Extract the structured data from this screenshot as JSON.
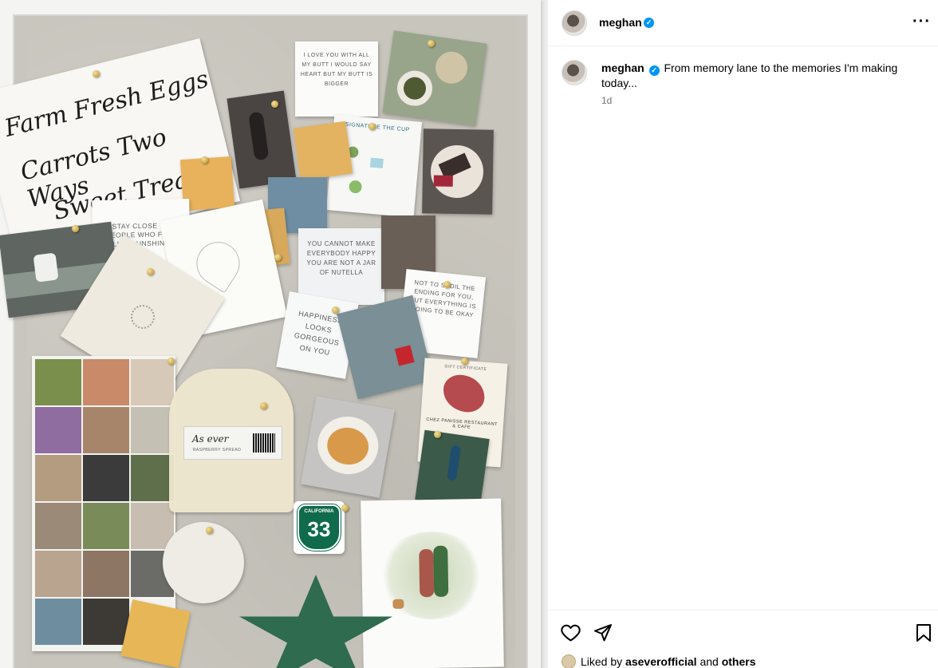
{
  "post": {
    "username": "meghan",
    "caption": {
      "username": "meghan",
      "text": "From memory lane to the memories I'm making today..."
    },
    "time": "1d",
    "likes": {
      "prefix": "Liked by",
      "user": "aseverofficial",
      "middle": "and",
      "others": "others"
    }
  },
  "icons": {
    "verified": "verified-badge-icon",
    "more": "more-options-icon",
    "like": "heart-icon",
    "share": "share-icon",
    "save": "bookmark-icon"
  },
  "colors": {
    "verified": "#0095f6",
    "border": "#efefef",
    "muted": "#737373"
  },
  "image": {
    "calligraphy_lines": [
      "Farm Fresh Eggs",
      "Carrots Two Ways",
      "Sweet Treats"
    ],
    "card_sunshine": "STAY CLOSE TO PEOPLE WHO FEEL LIKE SUNSHINE",
    "card_love": "I LOVE YOU WITH ALL MY BUTT I WOULD SAY HEART BUT MY BUTT IS BIGGER",
    "card_please": "YOU CANNOT MAKE EVERYBODY HAPPY YOU ARE NOT A JAR OF NUTELLA",
    "card_spoil": "NOT TO SPOIL THE ENDING FOR YOU, BUT EVERYTHING IS GOING TO BE OKAY",
    "card_gorgeous": "HAPPINESS LOOKS GORGEOUS ON YOU",
    "card_cup": "SIGNATURE THE CUP",
    "gift_cert": "GIFT CERTIFICATE",
    "gift_cert_name": "CHEZ PANISSE RESTAURANT & CAFE",
    "route_state": "CALIFORNIA",
    "route_number": "33",
    "label_brand": "As ever",
    "label_small": "RASPBERRY SPREAD"
  }
}
